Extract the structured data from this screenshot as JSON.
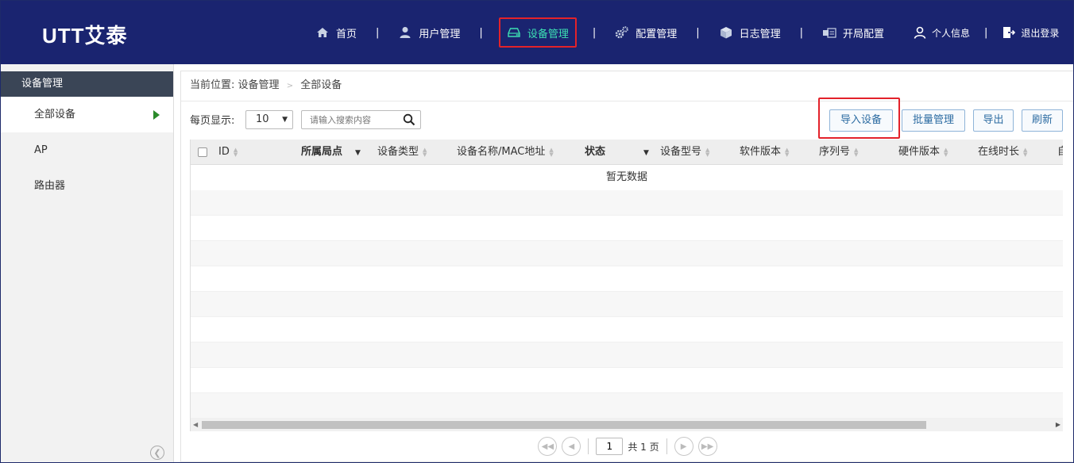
{
  "header": {
    "brand": "UTT艾泰",
    "nav": [
      {
        "label": "首页",
        "icon": "home-icon"
      },
      {
        "label": "用户管理",
        "icon": "user-icon"
      },
      {
        "label": "设备管理",
        "icon": "device-icon"
      },
      {
        "label": "配置管理",
        "icon": "gears-icon"
      },
      {
        "label": "日志管理",
        "icon": "cube-icon"
      },
      {
        "label": "开局配置",
        "icon": "setup-icon"
      }
    ],
    "separator": "|",
    "profile_label": "个人信息",
    "logout_label": "退出登录",
    "active_color": "#3de0b3",
    "highlight_color": "#e3222a"
  },
  "sidebar": {
    "title": "设备管理",
    "items": [
      {
        "label": "全部设备",
        "active": true
      },
      {
        "label": "AP",
        "active": false
      },
      {
        "label": "路由器",
        "active": false
      }
    ]
  },
  "main": {
    "breadcrumb": {
      "prefix": "当前位置:",
      "parent": "设备管理",
      "current": "全部设备"
    },
    "toolbar": {
      "per_page_label": "每页显示:",
      "per_page_value": "10",
      "search_placeholder": "请输入搜索内容",
      "import_label": "导入设备",
      "batch_label": "批量管理",
      "export_label": "导出",
      "refresh_label": "刷新"
    },
    "table": {
      "columns": {
        "id": "ID",
        "site": "所属局点",
        "type": "设备类型",
        "name_mac": "设备名称/MAC地址",
        "status": "状态",
        "model": "设备型号",
        "software": "软件版本",
        "serial": "序列号",
        "hardware": "硬件版本",
        "online": "在线时长",
        "cut": "自"
      },
      "empty_message": "暂无数据"
    },
    "pager": {
      "current_page": "1",
      "total_label": "共 1 页"
    }
  }
}
